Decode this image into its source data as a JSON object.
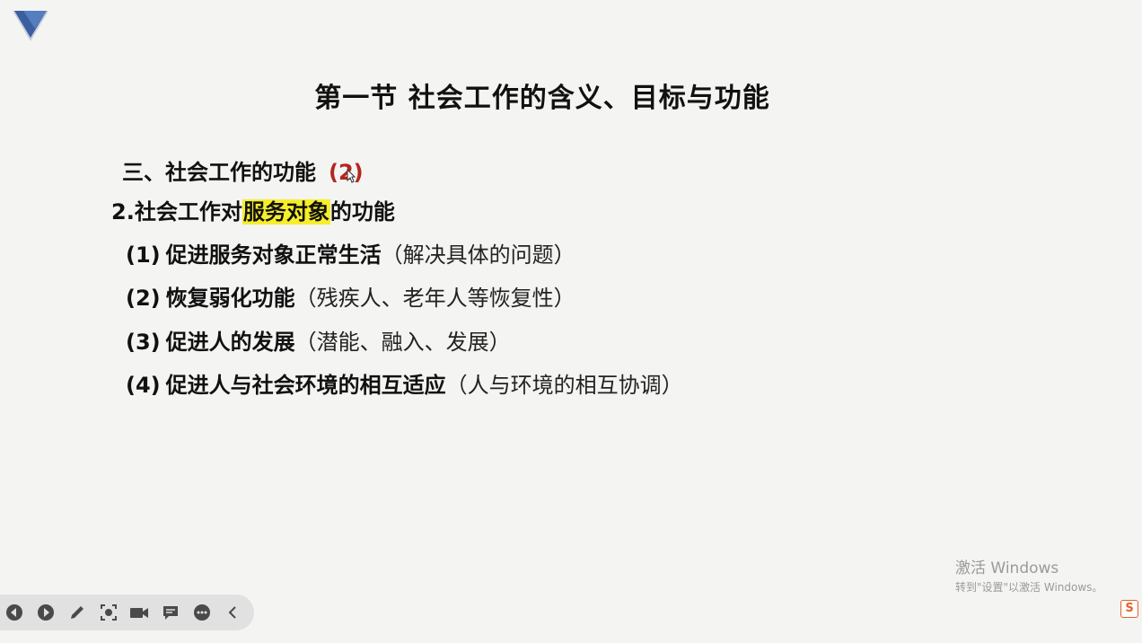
{
  "slide": {
    "title": "第一节 社会工作的含义、目标与功能",
    "section_label": "三、社会工作的功能",
    "section_number": "(2)",
    "subheading": {
      "prefix": "2.社会工作对",
      "highlight": "服务对象",
      "suffix": "的功能"
    },
    "items": [
      {
        "num": "(1)",
        "bold": "促进服务对象正常生活",
        "paren": "（解决具体的问题）"
      },
      {
        "num": "(2)",
        "bold": "恢复弱化功能",
        "paren": "（残疾人、老年人等恢复性）"
      },
      {
        "num": "(3)",
        "bold": "促进人的发展",
        "paren": "（潜能、融入、发展）"
      },
      {
        "num": "(4)",
        "bold": "促进人与社会环境的相互适应",
        "paren": "（人与环境的相互协调）"
      }
    ]
  },
  "watermark": {
    "line1": "激活 Windows",
    "line2": "转到\"设置\"以激活 Windows。"
  },
  "toolbar": {
    "icons": [
      "prev-icon",
      "next-icon",
      "pen-icon",
      "screenshot-icon",
      "camera-icon",
      "comment-icon",
      "more-icon",
      "collapse-icon"
    ]
  },
  "tray": {
    "sogou_label": "S"
  },
  "colors": {
    "accent_red": "#b3261e",
    "highlight_yellow": "#f6ee2a",
    "logo_blue": "#3b5f9e"
  }
}
